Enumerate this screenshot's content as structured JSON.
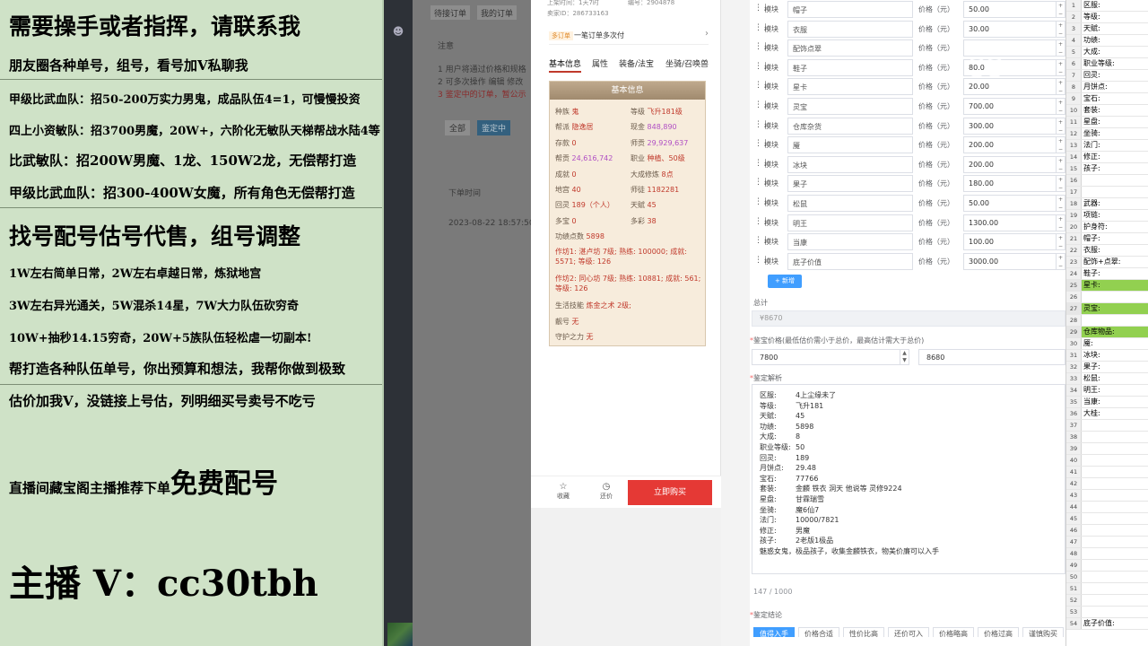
{
  "promo": {
    "line1": "需要操手或者指挥，请联系我",
    "line2": "朋友圈各种单号，组号，看号加V私聊我",
    "line3": "甲级比武血队：招50-200万实力男鬼，成品队伍4=1，可慢慢投资",
    "line4": "四上小资敏队：招3700男魔，20W+，六阶化无敏队天梯帮战水陆4等1",
    "line5": "比武敏队：招200W男魔、1龙、150W2龙，无偿帮打造",
    "line6": "甲级比武血队：招300-400W女魔，所有角色无偿帮打造",
    "line7": "找号配号估号代售，组号调整",
    "line8": "1W左右简单日常，2W左右卓越日常，炼狱地宫",
    "line9": "3W左右异光通关，5W混杀14星，7W大力队伍砍穷奇",
    "line10": "10W+抽秒14.15穷奇，20W+5族队伍轻松虐一切副本!",
    "line11": "帮打造各种队伍单号，你出预算和想法，我帮你做到极致",
    "line12": "估价加我V，没链接上号估，列明细买号卖号不吃亏",
    "line13a": "直播间藏宝阁主播推荐下单",
    "line13b": "免费配号",
    "line14": "主播 V：cc30tbh"
  },
  "admin": {
    "tab1": "待接订单",
    "tab2": "我的订单",
    "note_title": "注意",
    "note1": "1  用户将通过价格和规格",
    "note2": "2  可多次操作 编辑 修改",
    "note3": "3  鉴定中的订单，暂公示",
    "btn_all": "全部",
    "btn_active": "鉴定中",
    "col": "下单时间",
    "date": "2023-08-22 18:57:50"
  },
  "mobile": {
    "top1": "上架时间：1天7时",
    "top2": "编号：2904878",
    "top3": "卖家ID：286733163",
    "banner_badge": "多订单",
    "banner_text": "一笔订单多次付",
    "tabs": [
      "基本信息",
      "属性",
      "装备/法宝",
      "坐骑/召唤兽"
    ],
    "card_title": "基本信息",
    "fields": {
      "race_k": "种族",
      "race_v": "鬼",
      "level_k": "等级",
      "level_v": "飞升181级",
      "sect_k": "帮派",
      "sect_v": "隐逸居",
      "cash_k": "现金",
      "cash_v": "848,890",
      "deposit_k": "存款",
      "deposit_v": "0",
      "master_k": "师贡",
      "master_v": "29,929,637",
      "guild_k": "帮贡",
      "guild_v": "24,616,742",
      "job_k": "职业",
      "job_v": "种植、50级",
      "ach_k": "成就",
      "ach_v": "0",
      "cult_k": "大成修炼",
      "cult_v": "8点",
      "palace_k": "地宫",
      "palace_v": "40",
      "disc_k": "师徒",
      "disc_v": "1182281",
      "spirit_k": "回灵",
      "spirit_v": "189（个人）",
      "talent_k": "天赋",
      "talent_v": "45",
      "treasure_k": "多宝",
      "treasure_v": "0",
      "color_k": "多彩",
      "color_v": "38",
      "skill_k": "功绩点数",
      "skill_v": "5898",
      "work1": "作坊1: 湛卢坊 7级; 熟练: 100000; 成就: 5571; 等级: 126",
      "work2": "作坊2: 同心坊 7级; 熟练: 10881; 成就: 561; 等级: 126",
      "life_k": "生活技能",
      "life_v": "炼金之术 2级;",
      "pretty_k": "靓号",
      "pretty_v": "无",
      "guard_k": "守护之力",
      "guard_v": "无"
    },
    "fav": "收藏",
    "bargain": "还价",
    "buy": "立即购买"
  },
  "form": {
    "module_label": "模块",
    "price_label": "价格（元）",
    "rows": [
      {
        "name": "帽子",
        "price": "50.00"
      },
      {
        "name": "衣服",
        "price": "30.00"
      },
      {
        "name": "配饰点翠",
        "price": ""
      },
      {
        "name": "鞋子",
        "price": "80.0"
      },
      {
        "name": "星卡",
        "price": "20.00"
      },
      {
        "name": "灵宝",
        "price": "700.00"
      },
      {
        "name": "仓库杂货",
        "price": "300.00"
      },
      {
        "name": "魇",
        "price": "200.00"
      },
      {
        "name": "冰块",
        "price": "200.00"
      },
      {
        "name": "果子",
        "price": "180.00"
      },
      {
        "name": "松鼠",
        "price": "50.00"
      },
      {
        "name": "明王",
        "price": "1300.00"
      },
      {
        "name": "当康",
        "price": "100.00"
      },
      {
        "name": "底子价值",
        "price": "3000.00"
      }
    ],
    "add": "+ 新增",
    "total_label": "总计",
    "total_value": "¥8670",
    "range_label": "鉴宝价格(最低估价需小于总价，最高估计需大于总价)",
    "min_price": "7800",
    "max_price": "8680",
    "analysis_label": "鉴定解析",
    "analysis": [
      {
        "k": "区服:",
        "v": "4上尘缘未了"
      },
      {
        "k": "等级:",
        "v": "飞升181"
      },
      {
        "k": "天赋:",
        "v": "45"
      },
      {
        "k": "功绩:",
        "v": "5898"
      },
      {
        "k": "大成:",
        "v": "8"
      },
      {
        "k": "职业等级:",
        "v": "50"
      },
      {
        "k": "回灵:",
        "v": "189"
      },
      {
        "k": "月饼点:",
        "v": "29.48"
      },
      {
        "k": "宝石:",
        "v": "77766"
      },
      {
        "k": "套装:",
        "v": "金麟 铁衣 洞天 他说等 灵修9224"
      },
      {
        "k": "星盘:",
        "v": "甘霖瑞雪"
      },
      {
        "k": "坐骑:",
        "v": "魔6仙7"
      },
      {
        "k": "法门:",
        "v": "10000/7821"
      },
      {
        "k": "修正:",
        "v": "男魔"
      },
      {
        "k": "孩子:",
        "v": "2老版1极品"
      }
    ],
    "analysis_tail": "魅惑女鬼，极品孩子，收集金麟铁衣，物美价廉可以入手",
    "counter": "147 / 1000",
    "summary_label": "鉴定结论",
    "tags": [
      "值得入手",
      "价格合适",
      "性价比高",
      "还价可入",
      "价格略高",
      "价格过高",
      "谨慎购买"
    ]
  },
  "sheet": {
    "rows": [
      {
        "n": "1",
        "t": "区服:"
      },
      {
        "n": "2",
        "t": "等级:"
      },
      {
        "n": "3",
        "t": "天赋:"
      },
      {
        "n": "4",
        "t": "功绩:"
      },
      {
        "n": "5",
        "t": "大成:"
      },
      {
        "n": "6",
        "t": "职业等级:"
      },
      {
        "n": "7",
        "t": "回灵:"
      },
      {
        "n": "8",
        "t": "月饼点:"
      },
      {
        "n": "9",
        "t": "宝石:"
      },
      {
        "n": "10",
        "t": "套装:"
      },
      {
        "n": "11",
        "t": "星盘:"
      },
      {
        "n": "12",
        "t": "坐骑:"
      },
      {
        "n": "13",
        "t": "法门:"
      },
      {
        "n": "14",
        "t": "修正:"
      },
      {
        "n": "15",
        "t": "孩子:"
      },
      {
        "n": "16",
        "t": ""
      },
      {
        "n": "17",
        "t": ""
      },
      {
        "n": "18",
        "t": "武器:"
      },
      {
        "n": "19",
        "t": "项链:"
      },
      {
        "n": "20",
        "t": "护身符:"
      },
      {
        "n": "21",
        "t": "帽子:"
      },
      {
        "n": "22",
        "t": "衣服:"
      },
      {
        "n": "23",
        "t": "配饰+点翠:"
      },
      {
        "n": "24",
        "t": "鞋子:"
      },
      {
        "n": "25",
        "t": "星卡:"
      },
      {
        "n": "26",
        "t": ""
      },
      {
        "n": "27",
        "t": "灵宝:"
      },
      {
        "n": "28",
        "t": ""
      },
      {
        "n": "29",
        "t": "仓库物品:"
      },
      {
        "n": "30",
        "t": "魇:"
      },
      {
        "n": "31",
        "t": "冰块:"
      },
      {
        "n": "32",
        "t": "果子:"
      },
      {
        "n": "33",
        "t": "松鼠:"
      },
      {
        "n": "34",
        "t": "明王:"
      },
      {
        "n": "35",
        "t": "当康:"
      },
      {
        "n": "36",
        "t": "大桂:"
      },
      {
        "n": "37",
        "t": ""
      },
      {
        "n": "38",
        "t": ""
      },
      {
        "n": "39",
        "t": ""
      },
      {
        "n": "40",
        "t": ""
      },
      {
        "n": "41",
        "t": ""
      },
      {
        "n": "42",
        "t": ""
      },
      {
        "n": "43",
        "t": ""
      },
      {
        "n": "44",
        "t": ""
      },
      {
        "n": "45",
        "t": ""
      },
      {
        "n": "46",
        "t": ""
      },
      {
        "n": "47",
        "t": ""
      },
      {
        "n": "48",
        "t": ""
      },
      {
        "n": "49",
        "t": ""
      },
      {
        "n": "50",
        "t": ""
      },
      {
        "n": "51",
        "t": ""
      },
      {
        "n": "52",
        "t": ""
      },
      {
        "n": "53",
        "t": ""
      },
      {
        "n": "54",
        "t": "底子价值:"
      }
    ],
    "highlight_rows": [
      "25",
      "27",
      "29"
    ],
    "highlight_color": "#92d050"
  },
  "watermark": "CC"
}
